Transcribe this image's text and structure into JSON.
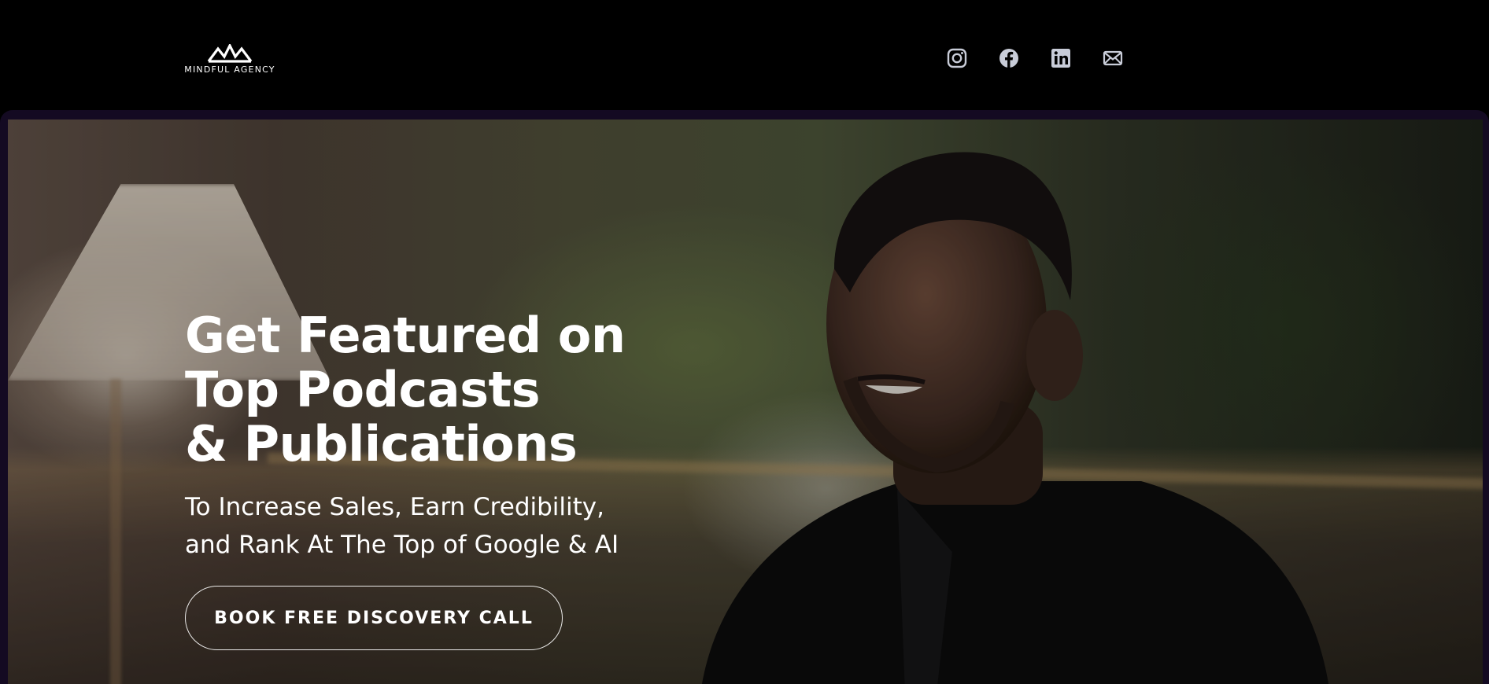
{
  "brand": {
    "name": "MINDFUL AGENCY",
    "logo_icon": "mountain-logo-icon"
  },
  "social": [
    {
      "name": "instagram",
      "icon": "instagram-icon"
    },
    {
      "name": "facebook",
      "icon": "facebook-icon"
    },
    {
      "name": "linkedin",
      "icon": "linkedin-icon"
    },
    {
      "name": "email",
      "icon": "mail-icon"
    }
  ],
  "hero": {
    "headline_lines": [
      "Get Featured on",
      "Top Podcasts",
      "& Publications"
    ],
    "subheadline_lines": [
      "To Increase Sales, Earn Credibility,",
      "and Rank At The Top of Google & AI"
    ],
    "cta_label": "BOOK FREE DISCOVERY CALL"
  },
  "colors": {
    "background": "#000000",
    "frame_accent": "#140a22",
    "icon": "#c8ccd8",
    "text": "#ffffff"
  }
}
